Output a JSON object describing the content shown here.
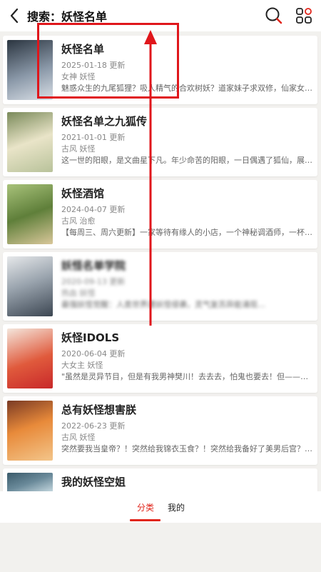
{
  "header": {
    "title": "搜索：妖怪名单"
  },
  "results": [
    {
      "name": "妖怪名单",
      "date": "2025-01-18 更新",
      "tags": "女神 妖怪",
      "desc": "魅惑众生的九尾狐狸？吸人精气的合欢树妖？道家妹子求双修，仙家女神…",
      "cover_colors": [
        "#2b3540",
        "#8a98a8",
        "#d9dfe6"
      ]
    },
    {
      "name": "妖怪名单之九狐传",
      "date": "2021-01-01 更新",
      "tags": "古风 妖怪",
      "desc": "这一世的阳眼，是文曲星下凡。年少命苦的阳眼，一日偶遇了狐仙，展开…",
      "cover_colors": [
        "#b8c29a",
        "#e9e4c8",
        "#7a8a5a"
      ]
    },
    {
      "name": "妖怪酒馆",
      "date": "2024-04-07 更新",
      "tags": "古风 治愈",
      "desc": "【每周三、周六更新】一家等待有缘人的小店，一个神秘调酒师，一杯化…",
      "cover_colors": [
        "#5f7f3a",
        "#a8c27a",
        "#d9c79a"
      ]
    },
    {
      "name": "妖怪名单学院",
      "date": "2020-09-13 更新",
      "tags": "热血 妖怪",
      "desc": "最强妖怪觉醒：人类世界遭妖怪侵袭，灵气复苏异能涌现…",
      "cover_colors": [
        "#3c4652",
        "#9aa4ae",
        "#e6e8ea"
      ]
    },
    {
      "name": "妖怪IDOLS",
      "date": "2020-06-04 更新",
      "tags": "大女主 妖怪",
      "desc": "\"虽然是灵异节目，但是有我男神樊川！去去去，怕鬼也要去！但——为什…",
      "cover_colors": [
        "#f4e6dc",
        "#e05a3c",
        "#c8282a"
      ]
    },
    {
      "name": "总有妖怪想害朕",
      "date": "2022-06-23 更新",
      "tags": "古风 妖怪",
      "desc": "突然要我当皇帝？！突然给我锦衣玉食？！突然给我备好了美男后宫？！…",
      "cover_colors": [
        "#e88a3a",
        "#f3c58a",
        "#7a3a24"
      ]
    },
    {
      "name": "我的妖怪空姐",
      "date": "",
      "tags": "",
      "desc": "",
      "cover_colors": [
        "#6a8a9a",
        "#c9dbe2",
        "#3a5a6a"
      ]
    }
  ],
  "bottom_tabs": [
    {
      "label": "分类",
      "active": true
    },
    {
      "label": "我的",
      "active": false
    }
  ],
  "colors": {
    "accent": "#e1251b",
    "annotation": "#e0161b"
  }
}
